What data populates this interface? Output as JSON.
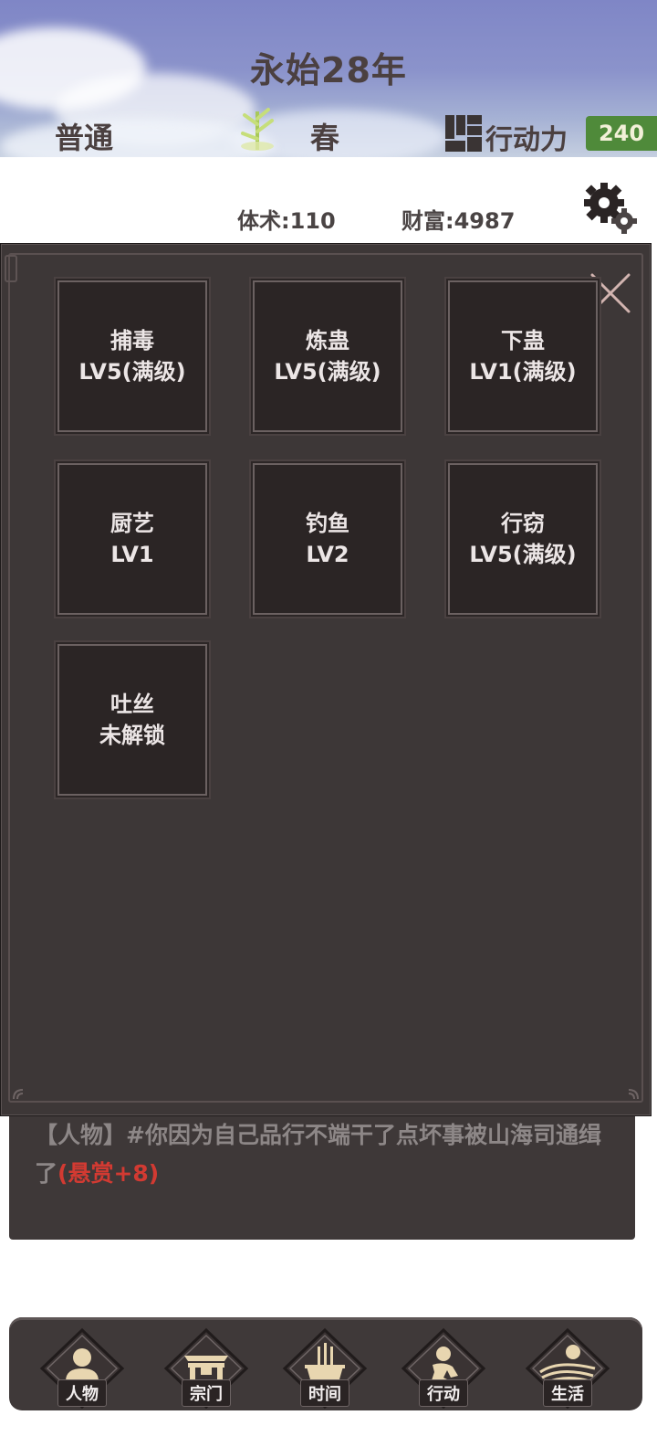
{
  "header": {
    "year_title": "永始28年",
    "mode": "普通",
    "season": "春",
    "action_points_label": "行动力",
    "action_points_value": "240",
    "season_icon": "bamboo-icon",
    "ap_icon": "action-points-icon"
  },
  "stats": {
    "stat1": "体术:110",
    "stat2": "财富:4987",
    "stat3": "",
    "stat4": ""
  },
  "skills_modal": {
    "close_icon": "close-icon",
    "skills": [
      {
        "name": "捕毒",
        "level": "LV5(满级)"
      },
      {
        "name": "炼蛊",
        "level": "LV5(满级)"
      },
      {
        "name": "下蛊",
        "level": "LV1(满级)"
      },
      {
        "name": "厨艺",
        "level": "LV1"
      },
      {
        "name": "钓鱼",
        "level": "LV2"
      },
      {
        "name": "行窃",
        "level": "LV5(满级)"
      },
      {
        "name": "吐丝",
        "level": "未解锁"
      }
    ]
  },
  "log": {
    "prefix": "【人物】",
    "text": "#你因为自己品行不端干了点坏事被山海司通缉了",
    "highlight": "(悬赏+8)"
  },
  "nav": {
    "items": [
      {
        "label": "人物",
        "icon": "person-icon"
      },
      {
        "label": "宗门",
        "icon": "sect-gate-icon"
      },
      {
        "label": "时间",
        "icon": "incense-burner-icon"
      },
      {
        "label": "行动",
        "icon": "action-figure-icon"
      },
      {
        "label": "生活",
        "icon": "life-landscape-icon"
      }
    ]
  },
  "colors": {
    "accent_green": "#4f8a3a",
    "highlight_red": "#d23a32",
    "panel_dark": "#3d3737"
  }
}
